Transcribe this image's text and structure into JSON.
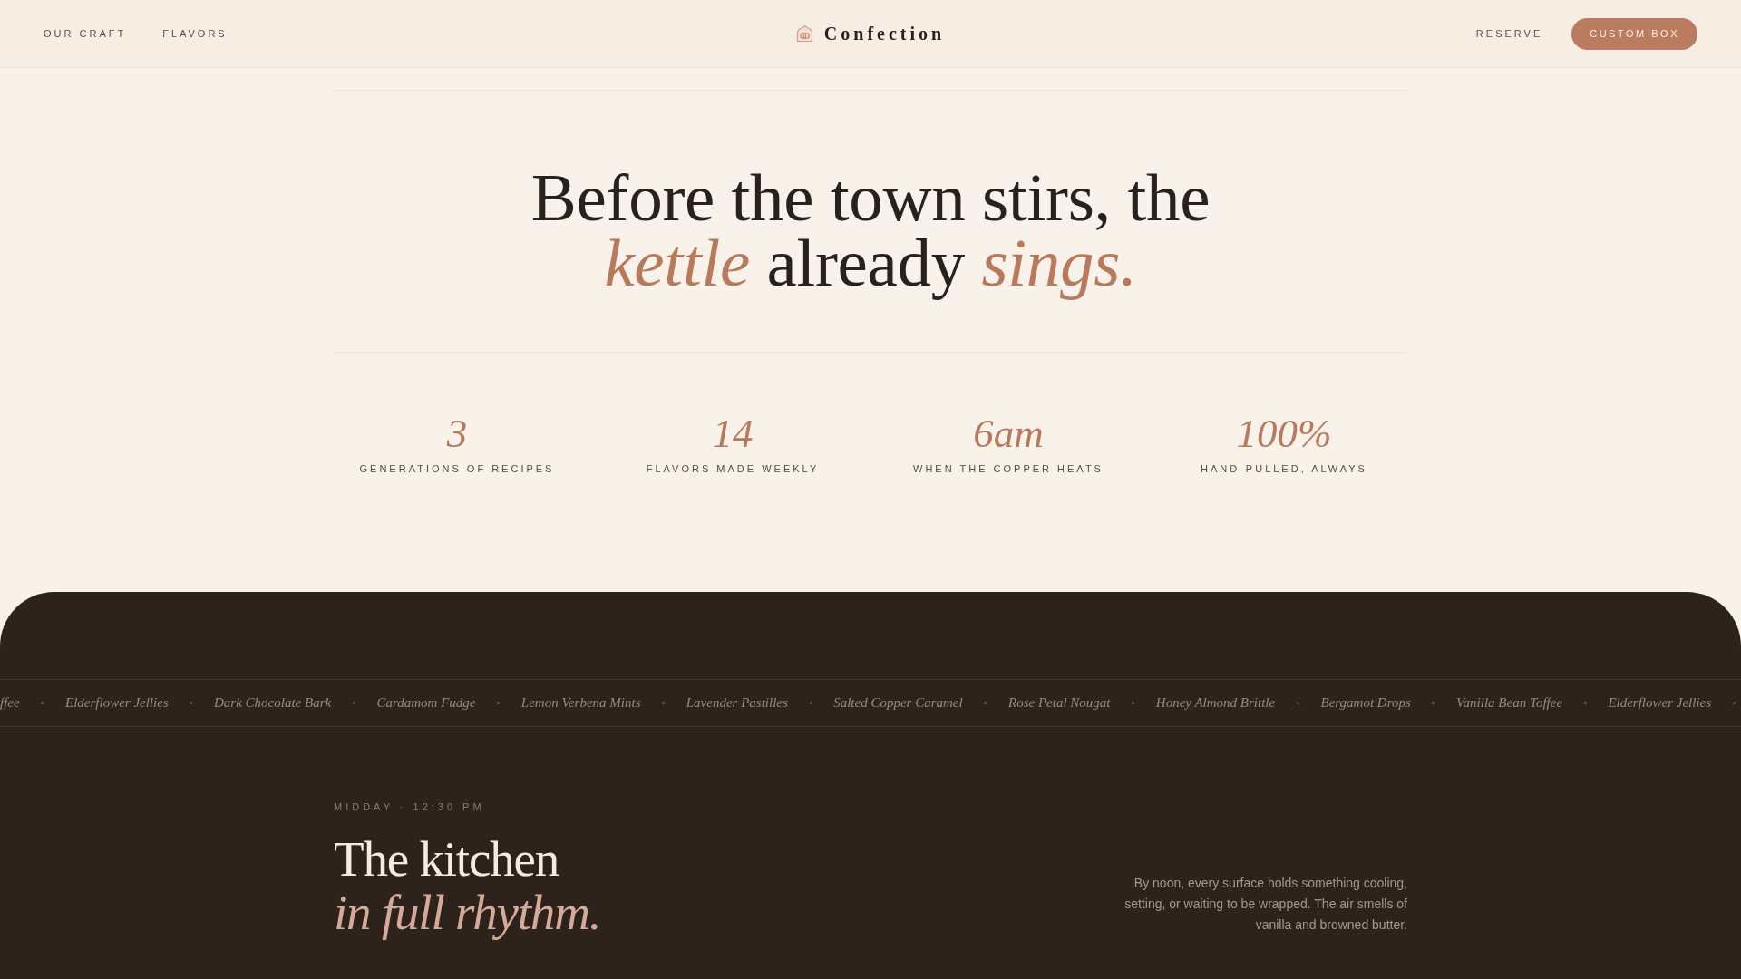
{
  "nav": {
    "links": [
      {
        "label": "OUR CRAFT"
      },
      {
        "label": "FLAVORS"
      }
    ],
    "brand": "Confection",
    "reserve": "RESERVE",
    "button": "CUSTOM BOX"
  },
  "hero": {
    "headline_lines": [
      "Before the town stirs, the",
      "*kettle* already *sings.*"
    ]
  },
  "stats": [
    {
      "value": "3",
      "label": "GENERATIONS OF RECIPES"
    },
    {
      "value": "14",
      "label": "FLAVORS MADE WEEKLY"
    },
    {
      "value": "6am",
      "label": "WHEN THE COPPER HEATS"
    },
    {
      "value": "100%",
      "label": "HAND-PULLED, ALWAYS"
    }
  ],
  "marquee": {
    "items": [
      "ffee",
      "Elderflower Jellies",
      "Dark Chocolate Bark",
      "Cardamom Fudge",
      "Lemon Verbena Mints",
      "Lavender Pastilles",
      "Salted Copper Caramel",
      "Rose Petal Nougat",
      "Honey Almond Brittle",
      "Bergamot Drops",
      "Vanilla Bean Toffee",
      "Elderflower Jellies"
    ]
  },
  "kitchen": {
    "eyebrow": "MIDDAY · 12:30 PM",
    "title_lines": [
      "The kitchen",
      "in full rhythm."
    ],
    "body": "By noon, every surface holds something cooling, setting, or waiting to be wrapped. The air smells of vanilla and browned butter."
  }
}
